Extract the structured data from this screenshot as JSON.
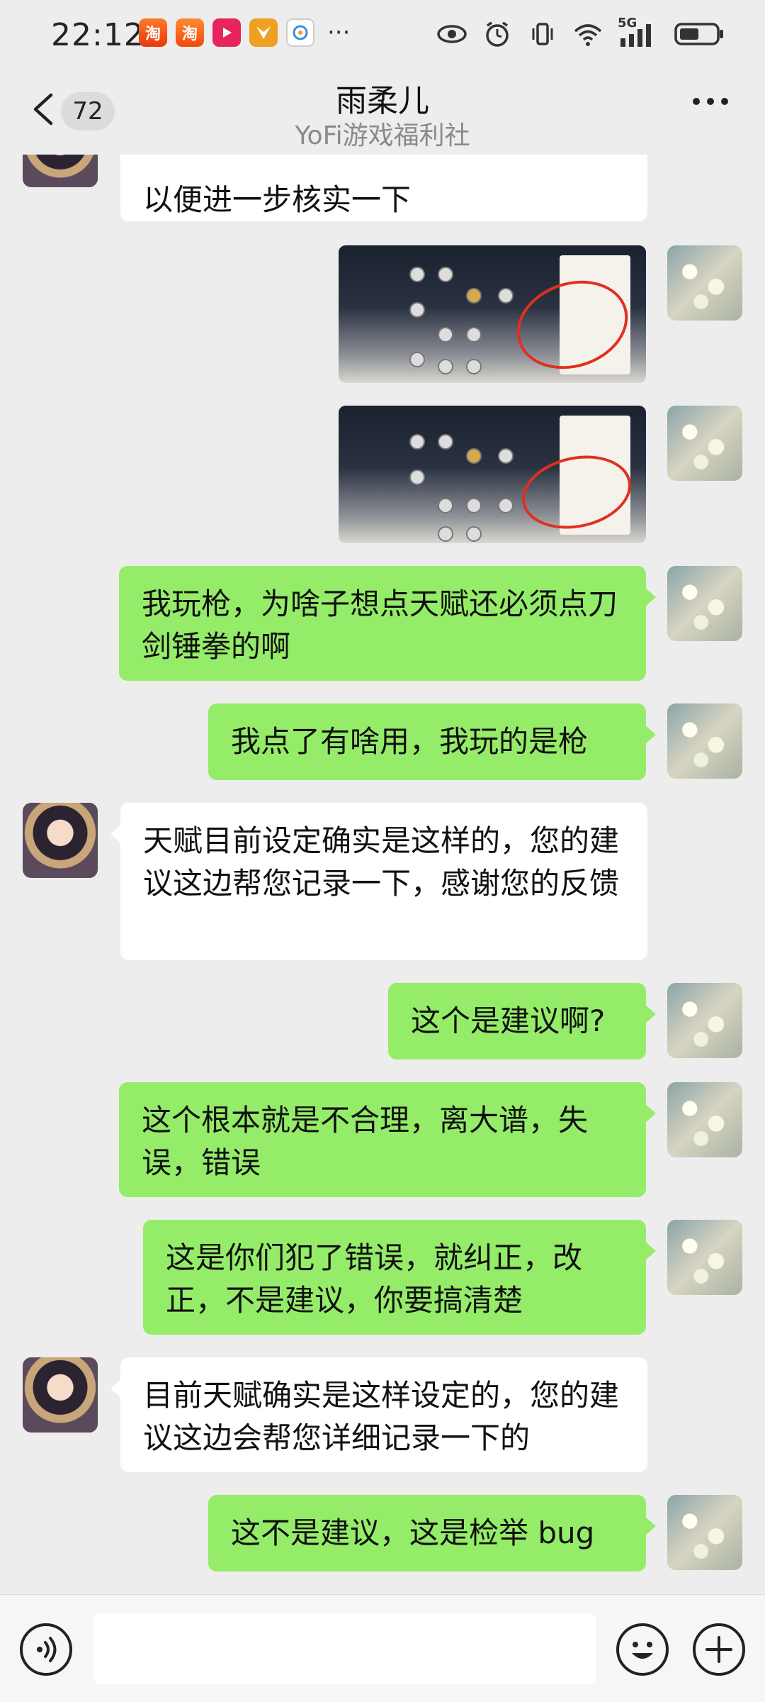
{
  "status_bar": {
    "time": "22:12",
    "app_icons": [
      "taobao-icon",
      "taobao-icon",
      "video-icon",
      "fox-icon",
      "browser-icon"
    ],
    "more": "···",
    "network_label": "5G"
  },
  "header": {
    "unread_count": "72",
    "title": "雨柔儿",
    "subtitle": "YoFi游戏福利社"
  },
  "messages": [
    {
      "side": "in",
      "type": "text",
      "text": "以便进一步核实一下"
    },
    {
      "side": "out",
      "type": "image"
    },
    {
      "side": "out",
      "type": "image"
    },
    {
      "side": "out",
      "type": "text",
      "text": "我玩枪，为啥子想点天赋还必须点刀剑锤拳的啊"
    },
    {
      "side": "out",
      "type": "text",
      "text": "我点了有啥用，我玩的是枪"
    },
    {
      "side": "in",
      "type": "text",
      "text": "天赋目前设定确实是这样的，您的建议这边帮您记录一下，感谢您的反馈"
    },
    {
      "side": "out",
      "type": "text",
      "text": "这个是建议啊?"
    },
    {
      "side": "out",
      "type": "text",
      "text": "这个根本就是不合理，离大谱，失误，错误"
    },
    {
      "side": "out",
      "type": "text",
      "text": "这是你们犯了错误，就纠正，改正，不是建议，你要搞清楚"
    },
    {
      "side": "in",
      "type": "text",
      "text": "目前天赋确实是这样设定的，您的建议这边会帮您详细记录一下的"
    },
    {
      "side": "out",
      "type": "text",
      "text": "这不是建议，这是检举 bug"
    }
  ],
  "colors": {
    "background": "#ededed",
    "outgoing_bubble": "#95ec69",
    "incoming_bubble": "#ffffff",
    "annotation_red": "#e03020"
  }
}
